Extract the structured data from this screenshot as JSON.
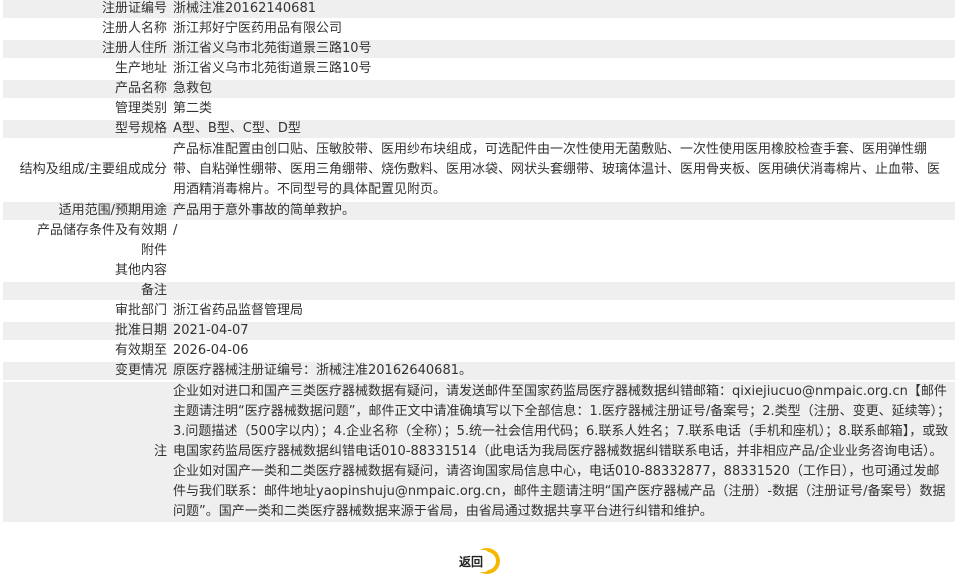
{
  "rows": [
    {
      "label": "注册证编号",
      "value": "浙械注准20162140681"
    },
    {
      "label": "注册人名称",
      "value": "浙江邦好宁医药用品有限公司"
    },
    {
      "label": "注册人住所",
      "value": "浙江省义乌市北苑街道景三路10号"
    },
    {
      "label": "生产地址",
      "value": "浙江省义乌市北苑街道景三路10号"
    },
    {
      "label": "产品名称",
      "value": "急救包"
    },
    {
      "label": "管理类别",
      "value": "第二类"
    },
    {
      "label": "型号规格",
      "value": "A型、B型、C型、D型"
    },
    {
      "label": "结构及组成/主要组成成分",
      "value": "产品标准配置由创口贴、压敏胶带、医用纱布块组成，可选配件由一次性使用无菌敷贴、一次性使用医用橡胶检查手套、医用弹性绷带、自粘弹性绷带、医用三角绷带、烧伤敷料、医用冰袋、网状头套绷带、玻璃体温计、医用骨夹板、医用碘伏消毒棉片、止血带、医用酒精消毒棉片。不同型号的具体配置见附页。"
    },
    {
      "label": "适用范围/预期用途",
      "value": "产品用于意外事故的简单救护。"
    },
    {
      "label": "产品储存条件及有效期",
      "value": "/"
    },
    {
      "label": "附件",
      "value": ""
    },
    {
      "label": "其他内容",
      "value": ""
    },
    {
      "label": "备注",
      "value": ""
    },
    {
      "label": "审批部门",
      "value": "浙江省药品监督管理局"
    },
    {
      "label": "批准日期",
      "value": "2021-04-07"
    },
    {
      "label": "有效期至",
      "value": "2026-04-06"
    },
    {
      "label": "变更情况",
      "value": "原医疗器械注册证编号：浙械注准20162640681。"
    },
    {
      "label": "注",
      "value": "企业如对进口和国产三类医疗器械数据有疑问，请发送邮件至国家药监局医疗器械数据纠错邮箱：qixiejiucuo@nmpaic.org.cn【邮件主题请注明“医疗器械数据问题”，邮件正文中请准确填写以下全部信息：1.医疗器械注册证号/备案号；2.类型（注册、变更、延续等）；3.问题描述（500字以内）；4.企业名称（全称）；5.统一社会信用代码；6.联系人姓名；7.联系电话（手机和座机）；8.联系邮箱】，或致电国家药监局医疗器械数据纠错电话010-88331514（此电话为我局医疗器械数据纠错联系电话，并非相应产品/企业业务咨询电话）。企业如对国产一类和二类医疗器械数据有疑问，请咨询国家局信息中心，电话010-88332877，88331520（工作日），也可通过发邮件与我们联系：邮件地址yaopinshuju@nmpaic.org.cn，邮件主题请注明“国产医疗器械产品（注册）-数据（注册证号/备案号）数据问题”。国产一类和二类医疗器械数据来源于省局，由省局通过数据共享平台进行纠错和维护。"
    }
  ],
  "back_button": {
    "label": "返回"
  },
  "colors": {
    "row_shade": "#efefef",
    "button_yellow": "#f5b800"
  }
}
